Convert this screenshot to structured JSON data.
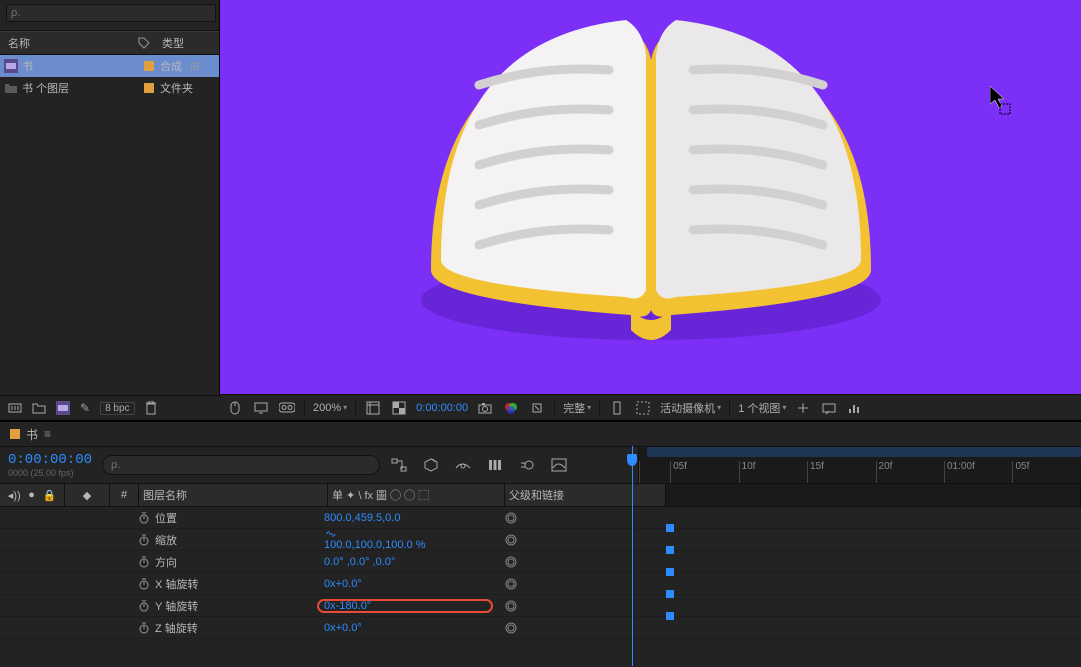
{
  "project": {
    "search_placeholder": "ρ.",
    "headers": {
      "name": "名称",
      "type": "类型"
    },
    "items": [
      {
        "name": "书",
        "type": "合成",
        "color": "#e0a040",
        "kind": "comp"
      },
      {
        "name": "书 个图层",
        "type": "文件夹",
        "color": "#e0a040",
        "kind": "folder"
      }
    ],
    "bpc": "8 bpc"
  },
  "comp_footer": {
    "zoom": "200%",
    "time": "0:00:00:00",
    "quality": "完整",
    "camera": "活动摄像机",
    "views": "1 个视图"
  },
  "timeline": {
    "tab": "书",
    "timecode": "0:00:00:00",
    "framerate": "0000 (25.00 fps)",
    "search_placeholder": "ρ.",
    "columns": {
      "name": "图层名称",
      "switches": "单 ✦ \\ fx 圖 ◯ ◯ ⬚",
      "parent": "父级和链接",
      "num": "#"
    },
    "ruler": [
      "",
      "05f",
      "10f",
      "15f",
      "20f",
      "01:00f",
      "05f"
    ],
    "props": [
      {
        "name": "位置",
        "value": "800.0,459.5,0.0",
        "track": true
      },
      {
        "name": "缩放",
        "value": "100.0,100.0,100.0 %",
        "chain": true,
        "track": true
      },
      {
        "name": "方向",
        "value": "0.0° ,0.0° ,0.0°",
        "track": true
      },
      {
        "name": "X 轴旋转",
        "value": "0x+0.0°",
        "track": true
      },
      {
        "name": "Y 轴旋转",
        "value": "0x-180.0°",
        "highlight": true,
        "track": true
      },
      {
        "name": "Z 轴旋转",
        "value": "0x+0.0°",
        "track": false
      }
    ]
  }
}
